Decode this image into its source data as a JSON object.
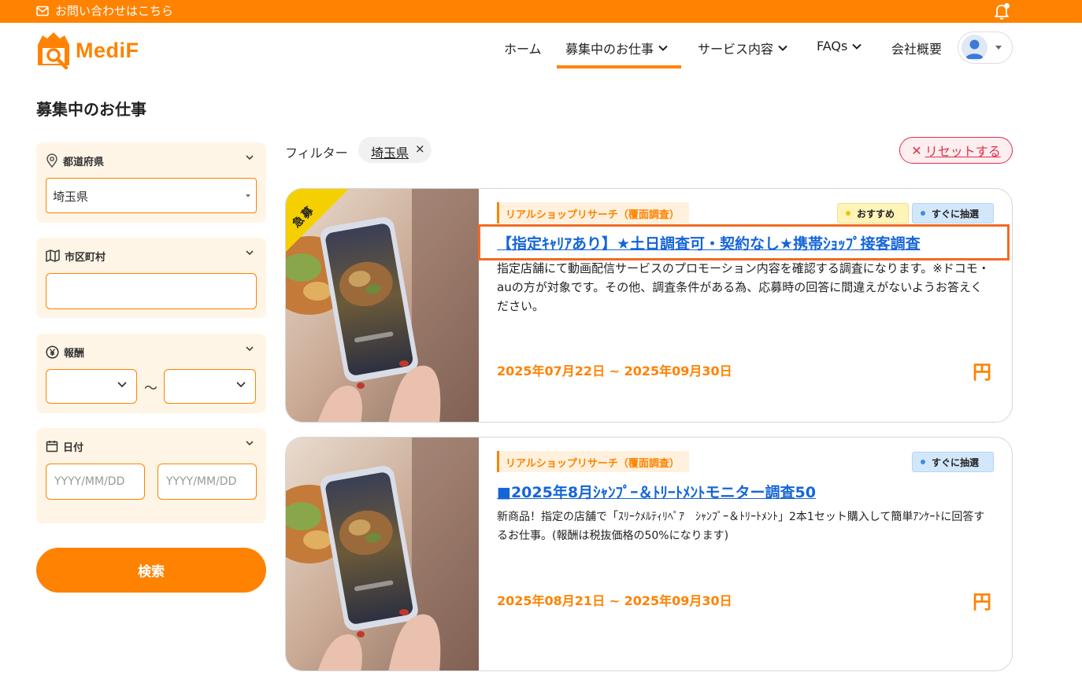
{
  "topbar": {
    "contact_text": "お問い合わせはこちら",
    "bg_color": "#ff8200"
  },
  "logo": {
    "text": "MediF"
  },
  "nav": {
    "home": "ホーム",
    "jobs": "募集中のお仕事",
    "services": "サービス内容",
    "faqs": "FAQs",
    "company": "会社概要"
  },
  "page_title": "募集中のお仕事",
  "sidebar": {
    "prefecture": {
      "label": "都道府県",
      "value": "埼玉県"
    },
    "city": {
      "label": "市区町村",
      "value": ""
    },
    "reward": {
      "label": "報酬",
      "from": "",
      "to": "",
      "separator": "〜"
    },
    "date": {
      "label": "日付",
      "from_placeholder": "YYYY/MM/DD",
      "to_placeholder": "YYYY/MM/DD"
    },
    "search_button": "検索"
  },
  "filter": {
    "label": "フィルター",
    "chip": "埼玉県",
    "chip_remove": "×",
    "reset": "リセットする",
    "reset_icon": "✕"
  },
  "jobs": [
    {
      "ribbon": "急募",
      "category": "リアルショップリサーチ（覆面調査）",
      "badges": [
        "おすすめ",
        "すぐに抽選"
      ],
      "title": "【指定ｷｬﾘｱあり】★土日調査可・契約なし★携帯ｼｮｯﾌﾟ接客調査",
      "description": "指定店舗にて動画配信サービスのプロモーション内容を確認する調査になります。※ドコモ・auの方が対象です。その他、調査条件がある為、応募時の回答に間違えがないようお答えください。",
      "period": "2025年07月22日 ~ 2025年09月30日",
      "currency": "円"
    },
    {
      "ribbon": "",
      "category": "リアルショップリサーチ（覆面調査）",
      "badges": [
        "すぐに抽選"
      ],
      "title": "■2025年8月ｼｬﾝﾌﾟｰ＆ﾄﾘｰﾄﾒﾝﾄモニター調査50",
      "description": "新商品！指定の店舗で「ｽﾘｰｸﾒﾙﾃｨﾘﾍﾟｱ　ｼｬﾝﾌﾟｰ＆ﾄﾘｰﾄﾒﾝﾄ」2本1セット購入して簡単ｱﾝｹｰﾄに回答するお仕事。(報酬は税抜価格の50%になります)",
      "period": "2025年08月21日 ~ 2025年09月30日",
      "currency": "円"
    }
  ]
}
